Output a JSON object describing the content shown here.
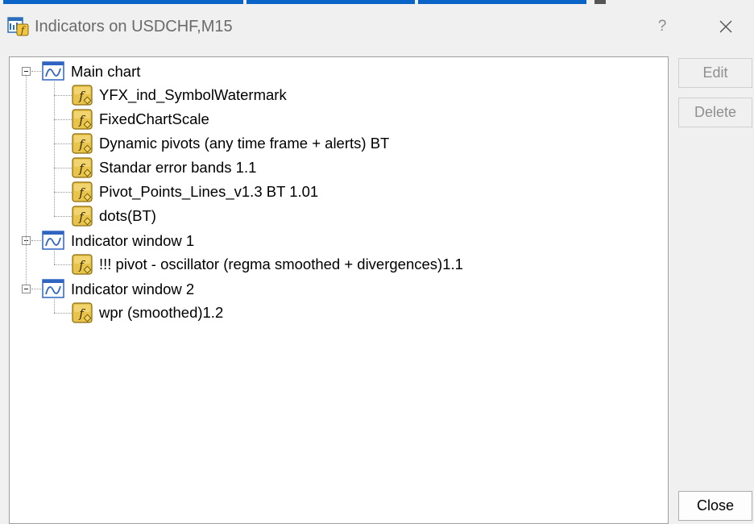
{
  "window": {
    "title": "Indicators on USDCHF,M15",
    "help_label": "?"
  },
  "buttons": {
    "edit": "Edit",
    "delete": "Delete",
    "close": "Close"
  },
  "tree": [
    {
      "label": "Main chart",
      "children": [
        "YFX_ind_SymbolWatermark",
        "FixedChartScale",
        "Dynamic pivots (any time frame + alerts) BT",
        "Standar error bands 1.1",
        "Pivot_Points_Lines_v1.3 BT 1.01",
        "dots(BT)"
      ]
    },
    {
      "label": "Indicator window 1",
      "children": [
        "!!! pivot - oscillator (regma smoothed + divergences)1.1"
      ]
    },
    {
      "label": "Indicator window 2",
      "children": [
        "wpr (smoothed)1.2"
      ]
    }
  ],
  "colors": {
    "accent": "#0a64c8",
    "indicator_icon": "#e8c44a"
  },
  "icons": {
    "app": "indicators-app-icon",
    "window": "chart-window-icon",
    "indicator": "custom-indicator-icon"
  }
}
